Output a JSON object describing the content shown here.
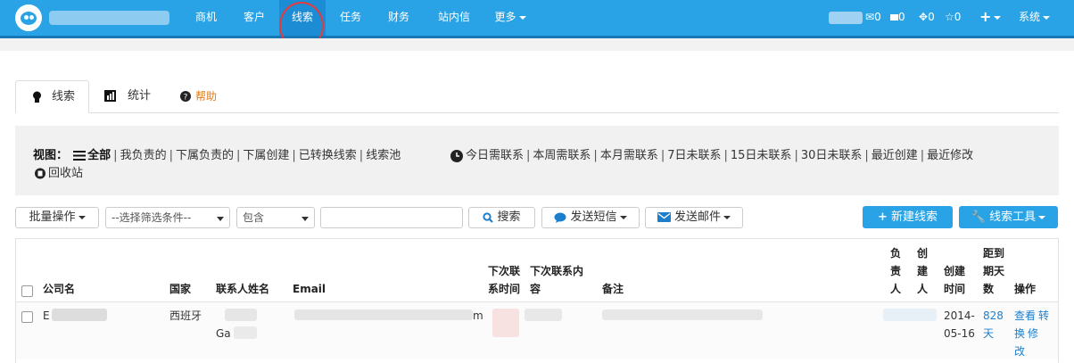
{
  "topbar": {
    "nav": [
      {
        "label": "商机"
      },
      {
        "label": "客户"
      },
      {
        "label": "线索"
      },
      {
        "label": "任务"
      },
      {
        "label": "财务"
      },
      {
        "label": "站内信"
      },
      {
        "label": "更多"
      }
    ],
    "counts": {
      "mail": "0",
      "msg": "0",
      "tasks": "0",
      "stars": "0"
    },
    "add_label": "+",
    "system_label": "系统"
  },
  "tabs": [
    {
      "label": "线索"
    },
    {
      "label": "统计"
    },
    {
      "label": "帮助"
    }
  ],
  "views": {
    "prefix": "视图：",
    "all": "全部",
    "line1_left": [
      "我负责的",
      "下属负责的",
      "下属创建",
      "已转换线索",
      "线索池"
    ],
    "line1_right": [
      "今日需联系",
      "本周需联系",
      "本月需联系",
      "7日未联系",
      "15日未联系",
      "30日未联系",
      "最近创建",
      "最近修改"
    ],
    "recycle": "回收站"
  },
  "toolbar": {
    "batch": "批量操作",
    "filter_placeholder": "--选择筛选条件--",
    "contains": "包含",
    "search": "搜索",
    "sms": "发送短信",
    "email": "发送邮件",
    "new_lead": "新建线索",
    "tools": "线索工具"
  },
  "table": {
    "headers": {
      "company": "公司名",
      "country": "国家",
      "contact": "联系人姓名",
      "email": "Email",
      "next_time_1": "下次联",
      "next_time_2": "系时间",
      "next_content_1": "下次联系内",
      "next_content_2": "容",
      "note": "备注",
      "owner_1": "负",
      "owner_2": "责",
      "owner_3": "人",
      "creator_1": "创",
      "creator_2": "建",
      "creator_3": "人",
      "created_1": "创建",
      "created_2": "时间",
      "due_1": "距到",
      "due_2": "期天",
      "due_3": "数",
      "ops": "操作"
    },
    "rows": [
      {
        "company": "E",
        "country": "西班牙",
        "contact_partial": "Ga",
        "email_tail": "m",
        "created_1": "2014-",
        "created_2": "05-16",
        "due_1": "828",
        "due_2": "天",
        "op_view": "查看",
        "op_convert_1": "转",
        "op_convert_2": "换",
        "op_edit": "修",
        "op_edit_2": "改"
      }
    ]
  },
  "colors": {
    "topbar": "#2aa3e6",
    "accent": "#2aa3e6",
    "link": "#1d7fcc",
    "help": "#e07b17",
    "highlight_circle": "#e53b3b"
  }
}
